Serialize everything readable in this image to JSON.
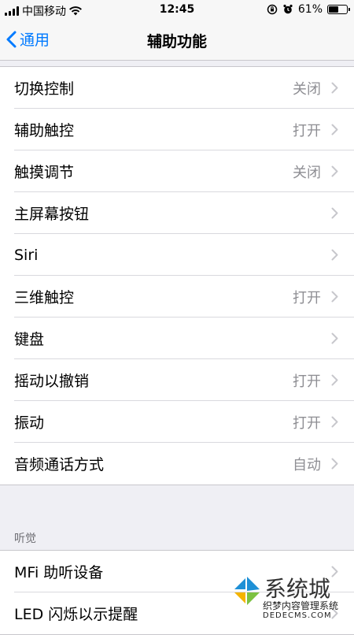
{
  "status_bar": {
    "carrier": "中国移动",
    "time": "12:45",
    "battery_percent": "61%",
    "battery_level": 0.61
  },
  "nav": {
    "back_label": "通用",
    "title": "辅助功能"
  },
  "groups": [
    {
      "rows": [
        {
          "label": "切换控制",
          "value": "关闭"
        },
        {
          "label": "辅助触控",
          "value": "打开"
        },
        {
          "label": "触摸调节",
          "value": "关闭"
        },
        {
          "label": "主屏幕按钮",
          "value": ""
        },
        {
          "label": "Siri",
          "value": ""
        },
        {
          "label": "三维触控",
          "value": "打开"
        },
        {
          "label": "键盘",
          "value": ""
        },
        {
          "label": "摇动以撤销",
          "value": "打开"
        },
        {
          "label": "振动",
          "value": "打开"
        },
        {
          "label": "音频通话方式",
          "value": "自动"
        }
      ]
    },
    {
      "header": "听觉",
      "rows": [
        {
          "label": "MFi 助听设备",
          "value": ""
        },
        {
          "label": "LED 闪烁以示提醒",
          "value": ""
        }
      ]
    }
  ],
  "watermark": {
    "title": "系统城",
    "line1": "织梦内容管理系统",
    "line2": "DEDECMS.COM"
  },
  "colors": {
    "accent": "#007aff",
    "value_gray": "#8e8e93",
    "background": "#efeff4"
  }
}
